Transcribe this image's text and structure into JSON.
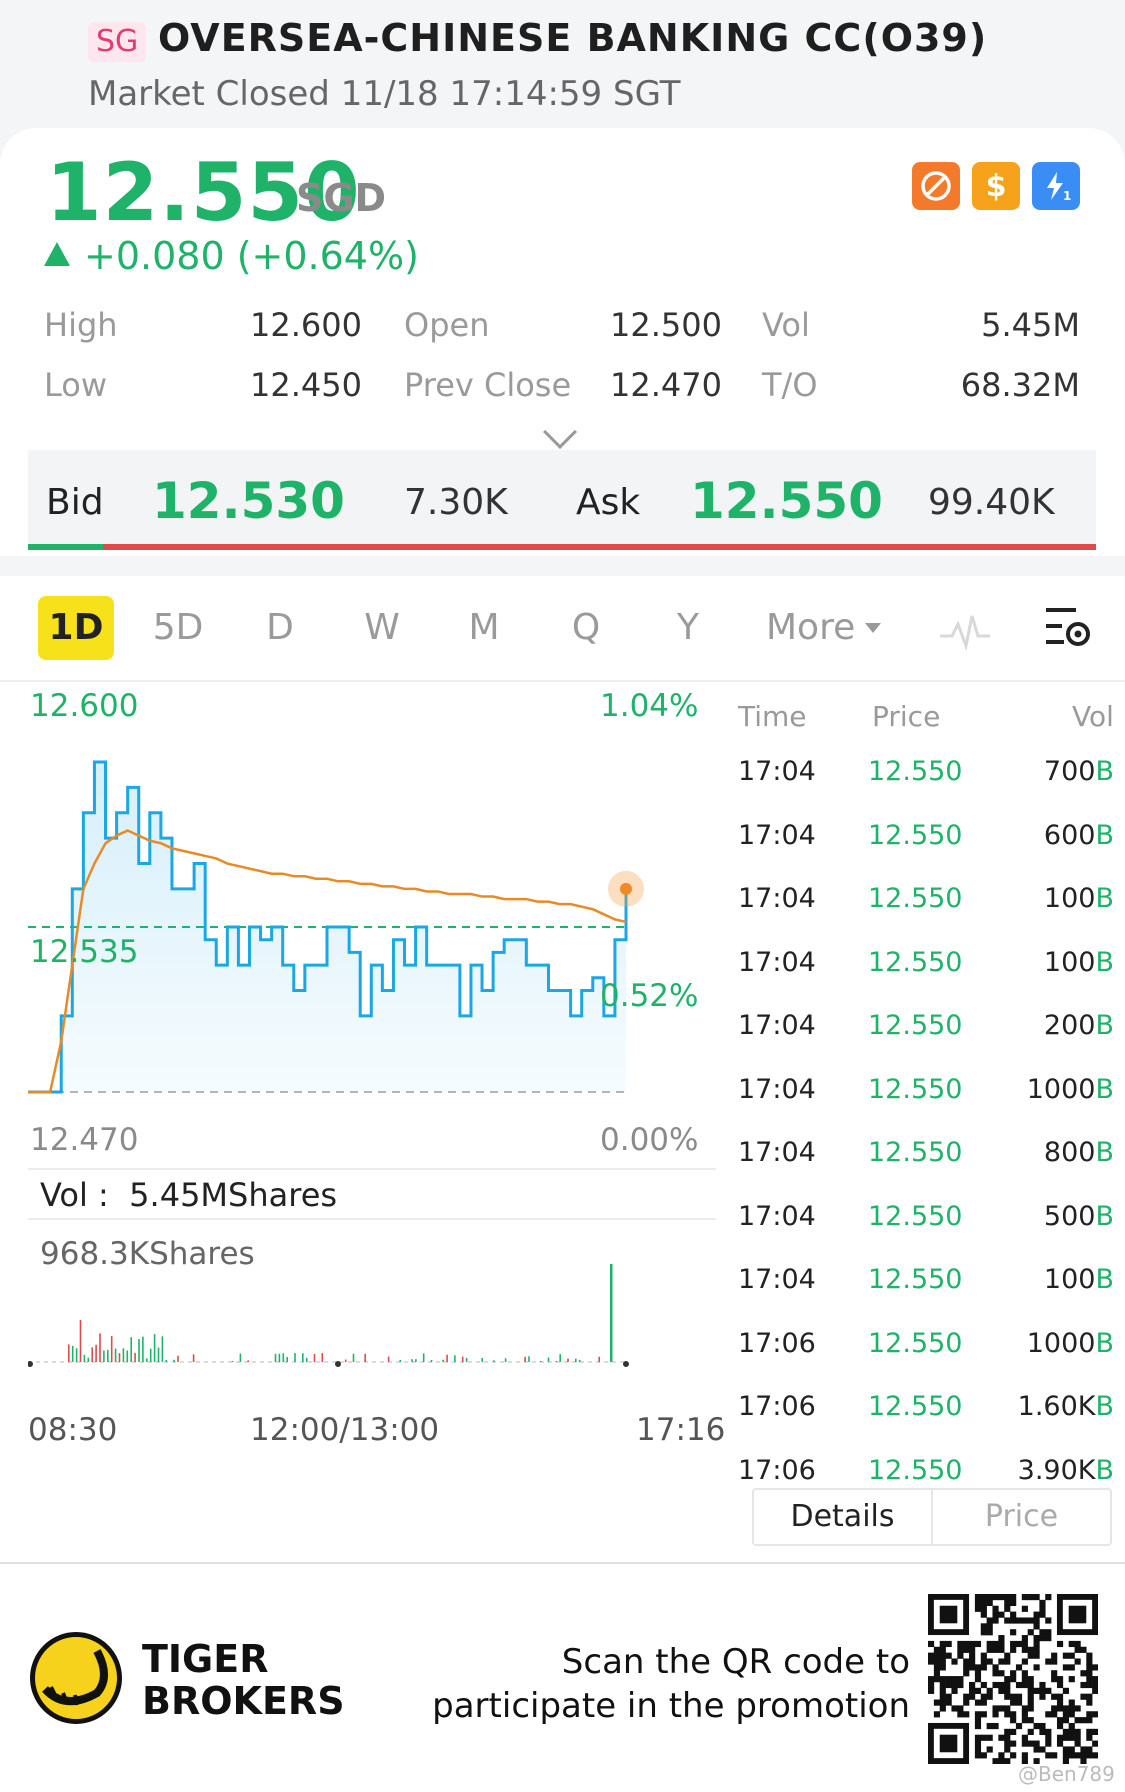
{
  "header": {
    "market_badge": "SG",
    "stock_name": "OVERSEA-CHINESE BANKING CC(O39)",
    "status": "Market Closed 11/18 17:14:59 SGT"
  },
  "quote": {
    "price": "12.550",
    "currency": "SGD",
    "change": "+0.080 (+0.64%)",
    "icons": [
      "no-short-icon",
      "dollar-icon",
      "lightning-level1-icon"
    ],
    "stats": [
      {
        "label": "High",
        "value": "12.600"
      },
      {
        "label": "Open",
        "value": "12.500"
      },
      {
        "label": "Vol",
        "value": "5.45M"
      },
      {
        "label": "Low",
        "value": "12.450"
      },
      {
        "label": "Prev Close",
        "value": "12.470"
      },
      {
        "label": "T/O",
        "value": "68.32M"
      }
    ],
    "bid": {
      "label": "Bid",
      "price": "12.530",
      "size": "7.30K"
    },
    "ask": {
      "label": "Ask",
      "price": "12.550",
      "size": "99.40K"
    },
    "bid_share": 0.07
  },
  "tabs": {
    "items": [
      "1D",
      "5D",
      "D",
      "W",
      "M",
      "Q",
      "Y"
    ],
    "active": "1D",
    "more": "More"
  },
  "chart": {
    "high_label": "12.600",
    "high_pct": "1.04%",
    "mid_label": "12.535",
    "mid_pct": "0.52%",
    "low_label": "12.470",
    "low_pct": "0.00%",
    "vol_label": "Vol :",
    "vol_value": "5.45MShares",
    "vol_max": "968.3KShares",
    "time_labels": [
      "08:30",
      "12:00/13:00",
      "17:16"
    ]
  },
  "chart_data": {
    "type": "line",
    "ylim": [
      12.47,
      12.6
    ],
    "series": [
      {
        "values": [
          12.47,
          12.47,
          12.47,
          12.5,
          12.55,
          12.58,
          12.6,
          12.57,
          12.58,
          12.59,
          12.56,
          12.58,
          12.57,
          12.55,
          12.55,
          12.56,
          12.53,
          12.52,
          12.535,
          12.52,
          12.535,
          12.53,
          12.535,
          12.52,
          12.51,
          12.52,
          12.52,
          12.535,
          12.535,
          12.525,
          12.5,
          12.52,
          12.51,
          12.53,
          12.52,
          12.535,
          12.52,
          12.52,
          12.52,
          12.5,
          12.52,
          12.51,
          12.525,
          12.53,
          12.53,
          12.52,
          12.52,
          12.51,
          12.51,
          12.5,
          12.51,
          12.515,
          12.5,
          12.53,
          12.55
        ]
      },
      {
        "values": [
          12.47,
          12.47,
          12.47,
          12.49,
          12.52,
          12.55,
          12.56,
          12.568,
          12.571,
          12.573,
          12.571,
          12.569,
          12.568,
          12.566,
          12.565,
          12.564,
          12.563,
          12.562,
          12.56,
          12.559,
          12.558,
          12.557,
          12.556,
          12.556,
          12.555,
          12.555,
          12.554,
          12.554,
          12.553,
          12.553,
          12.552,
          12.552,
          12.551,
          12.551,
          12.55,
          12.55,
          12.549,
          12.549,
          12.548,
          12.548,
          12.548,
          12.547,
          12.547,
          12.546,
          12.546,
          12.546,
          12.545,
          12.545,
          12.544,
          12.544,
          12.543,
          12.542,
          12.54,
          12.538,
          12.537
        ]
      }
    ]
  },
  "trades": {
    "headers": [
      "Time",
      "Price",
      "Vol"
    ],
    "rows": [
      {
        "time": "17:04",
        "price": "12.550",
        "vol": "700",
        "side": "B"
      },
      {
        "time": "17:04",
        "price": "12.550",
        "vol": "600",
        "side": "B"
      },
      {
        "time": "17:04",
        "price": "12.550",
        "vol": "100",
        "side": "B"
      },
      {
        "time": "17:04",
        "price": "12.550",
        "vol": "100",
        "side": "B"
      },
      {
        "time": "17:04",
        "price": "12.550",
        "vol": "200",
        "side": "B"
      },
      {
        "time": "17:04",
        "price": "12.550",
        "vol": "1000",
        "side": "B"
      },
      {
        "time": "17:04",
        "price": "12.550",
        "vol": "800",
        "side": "B"
      },
      {
        "time": "17:04",
        "price": "12.550",
        "vol": "500",
        "side": "B"
      },
      {
        "time": "17:04",
        "price": "12.550",
        "vol": "100",
        "side": "B"
      },
      {
        "time": "17:06",
        "price": "12.550",
        "vol": "1000",
        "side": "B"
      },
      {
        "time": "17:06",
        "price": "12.550",
        "vol": "1.60K",
        "side": "B"
      },
      {
        "time": "17:06",
        "price": "12.550",
        "vol": "3.90K",
        "side": "B"
      }
    ],
    "details_tab": "Details",
    "price_tab": "Price"
  },
  "promo": {
    "brand_line1": "TIGER",
    "brand_line2": "BROKERS",
    "text_line1": "Scan the QR code to",
    "text_line2": "participate in the promotion",
    "handle": "@Ben789"
  },
  "colors": {
    "green": "#1fb36a",
    "red": "#e24a4a",
    "line": "#1ba6e6",
    "avg": "#e88a25",
    "accent": "#f7e11a"
  }
}
